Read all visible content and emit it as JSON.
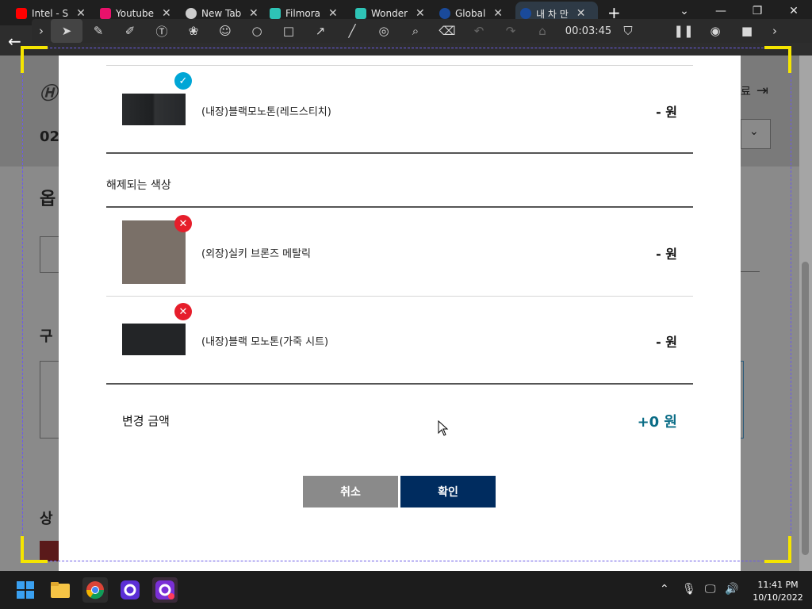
{
  "browser": {
    "tabs": [
      {
        "label": "Intel - S",
        "icon_color": "#ff0000"
      },
      {
        "label": "Youtube",
        "icon_color": "#e9116b"
      },
      {
        "label": "New Tab",
        "icon_color": "#cccccc"
      },
      {
        "label": "Filmora",
        "icon_color": "#2ec4b6"
      },
      {
        "label": "Wonder",
        "icon_color": "#2ec4b6"
      },
      {
        "label": "Global",
        "icon_color": "#1a4a9a"
      },
      {
        "label": "내 차 만",
        "icon_color": "#1a4a9a"
      }
    ],
    "new_tab": "+"
  },
  "recorder": {
    "timer": "00:03:45",
    "frame_color": "#f5e500",
    "dash_color": "#6c5ce7"
  },
  "background_page": {
    "date_fragment": "02",
    "heading_fragment": "옵",
    "section_fragment_1": "구",
    "section_fragment_2": "상",
    "logout_fragment": "료"
  },
  "modal": {
    "included_item": {
      "name": "(내장)블랙모노톤(레드스티치)",
      "price": "- 원",
      "badge": "check"
    },
    "released_section_title": "해제되는 색상",
    "released_items": [
      {
        "name": "(외장)실키 브론즈 메탈릭",
        "price": "- 원",
        "badge": "x",
        "swatch_color": "#7a7068"
      },
      {
        "name": "(내장)블랙 모노톤(가죽 시트)",
        "price": "- 원",
        "badge": "x",
        "swatch_color": "#232527"
      }
    ],
    "total_label": "변경 금액",
    "total_value": "+0 원",
    "cancel_label": "취소",
    "confirm_label": "확인",
    "accent_color": "#002c5f"
  },
  "taskbar": {
    "clock_time": "11:41 PM",
    "clock_date": "10/10/2022"
  }
}
